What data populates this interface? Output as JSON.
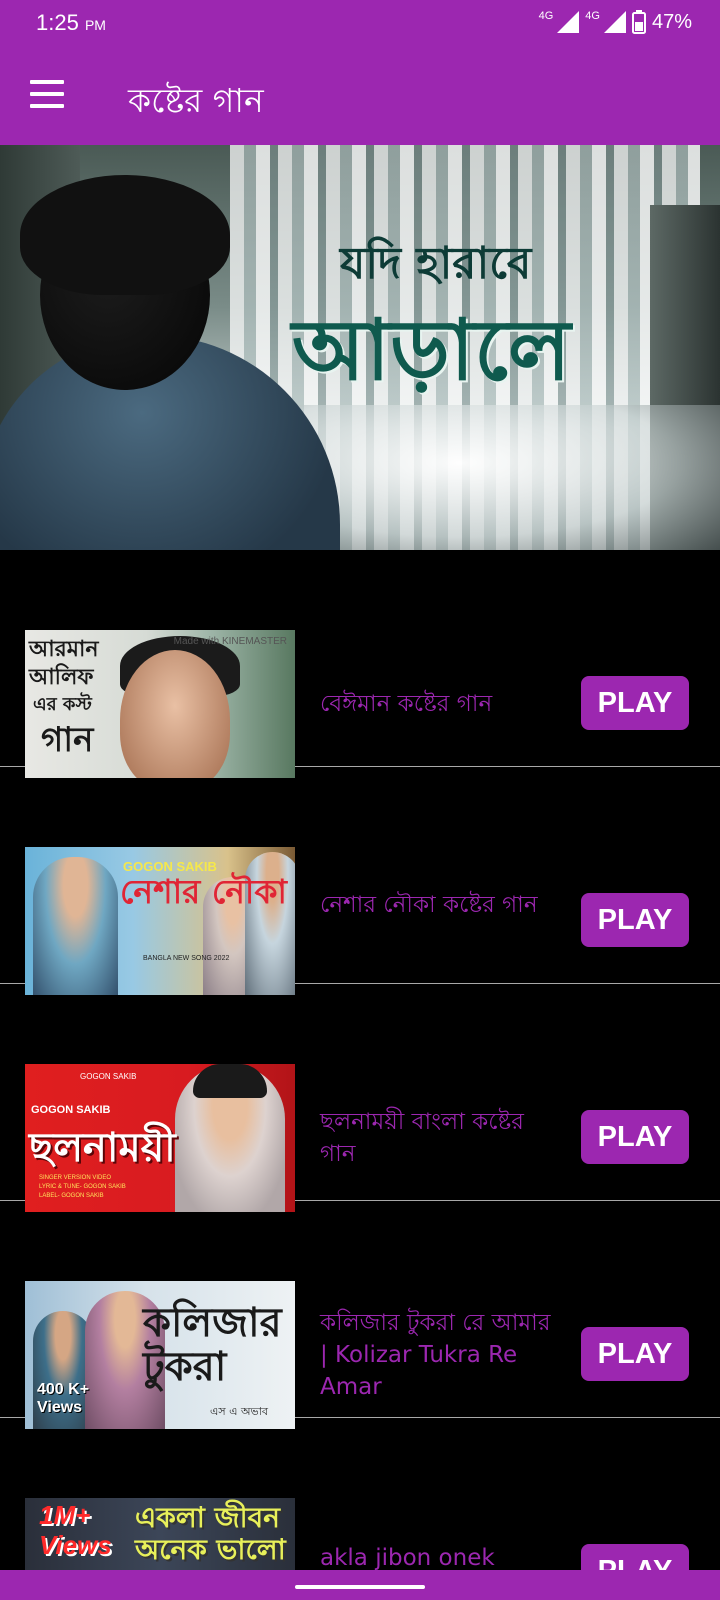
{
  "status_bar": {
    "time": "1:25",
    "ampm": "PM",
    "network_1": "4G",
    "network_2": "4G",
    "battery": "47%"
  },
  "app_bar": {
    "title": "কষ্টের গান",
    "menu_icon": "hamburger-menu-icon"
  },
  "hero": {
    "line1": "যদি হারাবে",
    "line2": "আড়ালে"
  },
  "songs": [
    {
      "title": "বেঈমান কষ্টের গান",
      "play_label": "PLAY",
      "thumb": {
        "line1": "আরমান",
        "line2": "আলিফ",
        "line3": "এর কস্ট",
        "line4": "গান",
        "mark": "Made with KINEMASTER"
      }
    },
    {
      "title": "নেশার নৌকা কষ্টের গান",
      "play_label": "PLAY",
      "thumb": {
        "brand": "GOGON SAKIB",
        "big": "নেশার নৌকা",
        "tag": "BANGLA NEW SONG 2022"
      }
    },
    {
      "title": "ছলনাময়ী বাংলা কষ্টের গান",
      "play_label": "PLAY",
      "thumb": {
        "top": "GOGON SAKIB",
        "sub": "GOGON SAKIB",
        "big": "ছলনাময়ী",
        "small1": "SINGER VERSION VIDEO",
        "small2": "LYRIC & TUNE- GOGON SAKIB",
        "small3": "LABEL- GOGON SAKIB"
      }
    },
    {
      "title": "কলিজার টুকরা রে আমার | Kolizar Tukra Re Amar",
      "play_label": "PLAY",
      "thumb": {
        "big": "কলিজার টুকরা",
        "views1": "400 K+",
        "views2": "Views",
        "credit": "এস এ অভাব"
      }
    },
    {
      "title": "akla jibon onek bhalo",
      "play_label": "PLAY",
      "thumb": {
        "views1": "1M+",
        "views2": "Views",
        "big1": "একলা জীবন",
        "big2": "অনেক ভালো"
      }
    }
  ],
  "colors": {
    "primary": "#9c27b0",
    "background": "#000000",
    "divider": "#a8a8a8"
  }
}
